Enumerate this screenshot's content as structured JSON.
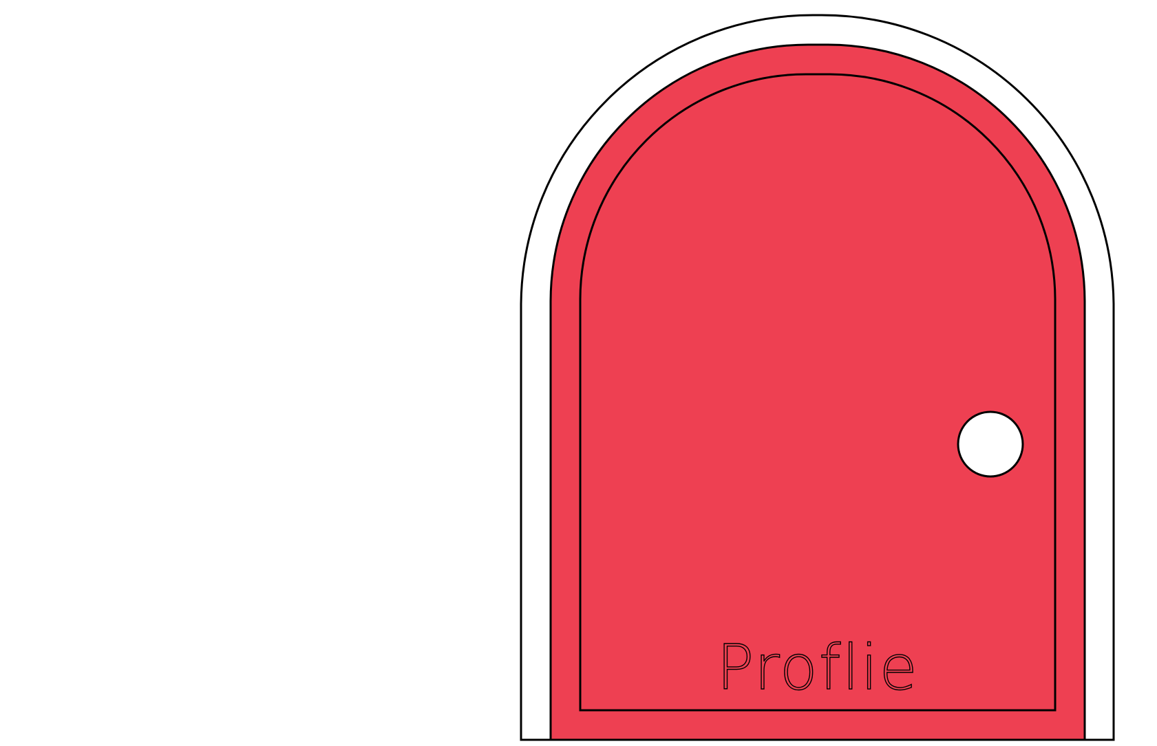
{
  "door": {
    "label": "Proflie",
    "colors": {
      "door_fill": "#EE4052",
      "frame_fill": "#FFFFFF",
      "knob_fill": "#FFFFFF",
      "outline": "#000000",
      "background": "#FFFFFF"
    },
    "icons": {
      "knob": "door-knob-icon"
    }
  }
}
